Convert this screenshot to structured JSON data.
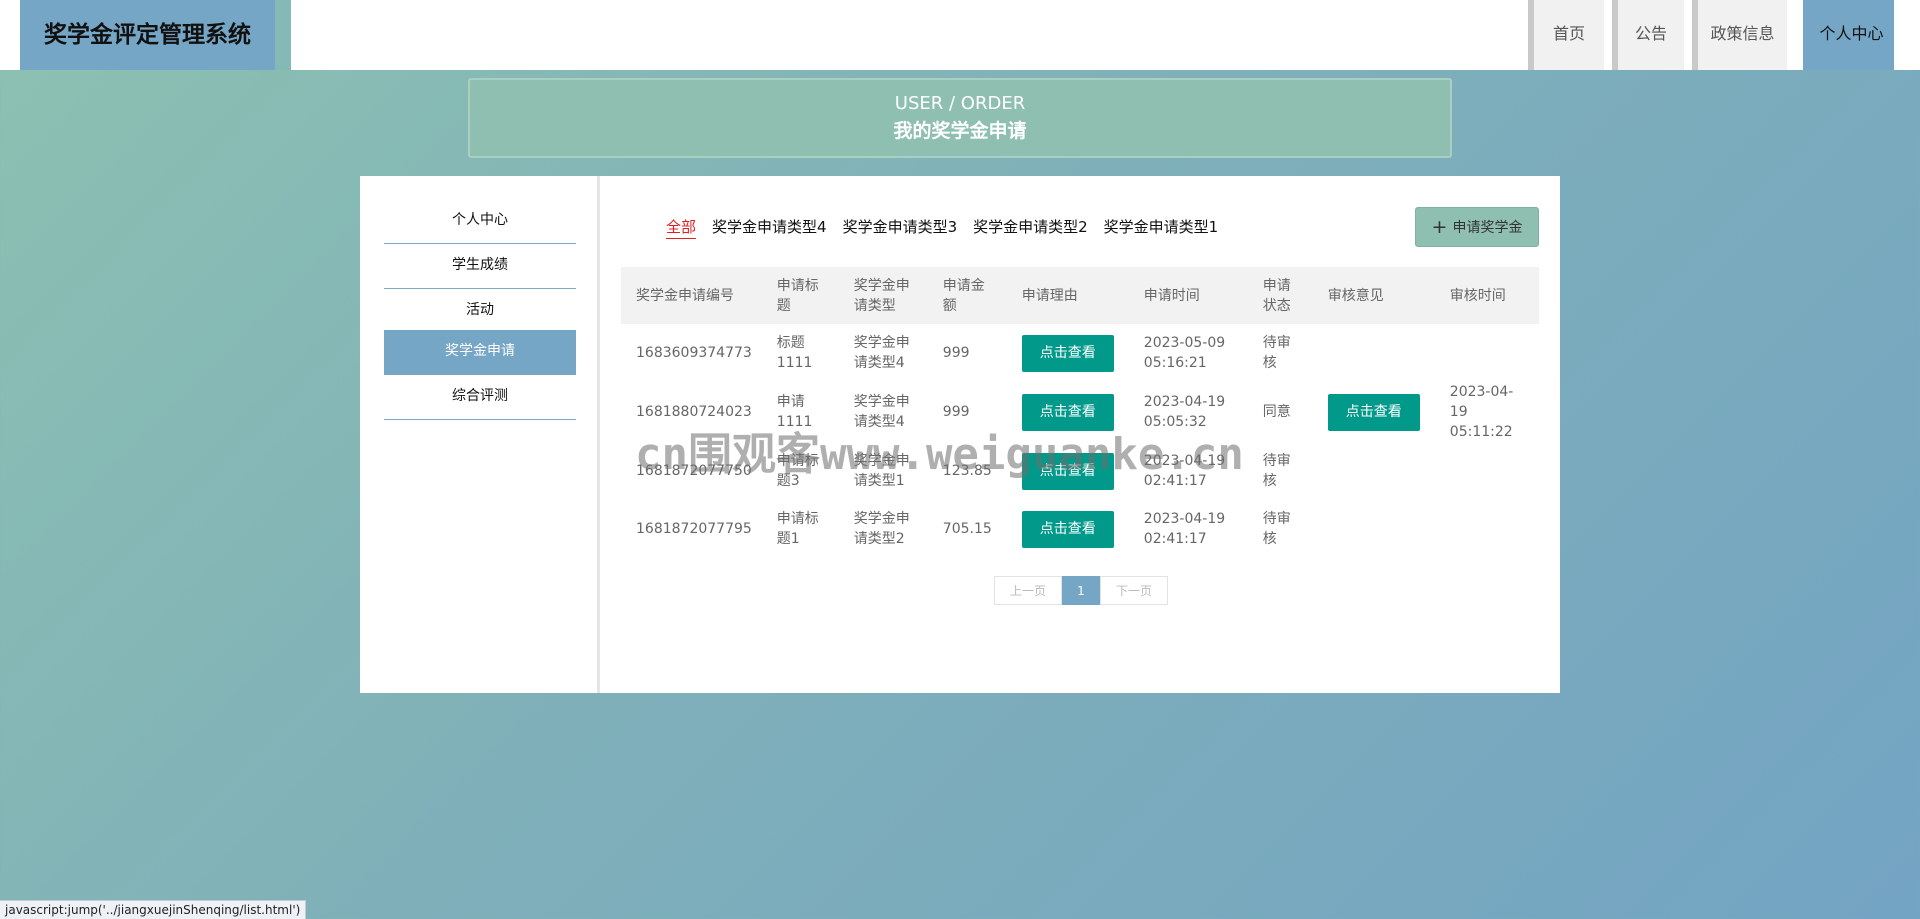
{
  "app": {
    "title": "奖学金评定管理系统"
  },
  "nav": {
    "items": [
      "首页",
      "公告",
      "政策信息",
      "个人中心"
    ],
    "active": "个人中心"
  },
  "header": {
    "en": "USER / ORDER",
    "zh": "我的奖学金申请"
  },
  "sidebar": {
    "items": [
      "个人中心",
      "学生成绩",
      "活动",
      "奖学金申请",
      "综合评测"
    ],
    "active": "奖学金申请"
  },
  "filter_tabs": {
    "items": [
      "全部",
      "奖学金申请类型4",
      "奖学金申请类型3",
      "奖学金申请类型2",
      "奖学金申请类型1"
    ],
    "active": "全部"
  },
  "apply_button": {
    "icon": "plus-icon",
    "label": "申请奖学金"
  },
  "table": {
    "headers": [
      "奖学金申请编号",
      "申请标题",
      "奖学金申请类型",
      "申请金额",
      "申请理由",
      "申请时间",
      "申请状态",
      "审核意见",
      "审核时间"
    ],
    "view_label": "点击查看",
    "rows": [
      {
        "no": "1683609374773",
        "title": "标题1111",
        "type": "奖学金申请类型4",
        "amount": "999",
        "time": "2023-05-09 05:16:21",
        "status": "待审核",
        "opinion": "",
        "review_time": ""
      },
      {
        "no": "1681880724023",
        "title": "申请1111",
        "type": "奖学金申请类型4",
        "amount": "999",
        "time": "2023-04-19 05:05:32",
        "status": "同意",
        "opinion": "点击查看",
        "review_time": "2023-04-19 05:11:22"
      },
      {
        "no": "1681872077750",
        "title": "申请标题3",
        "type": "奖学金申请类型1",
        "amount": "123.85",
        "time": "2023-04-19 02:41:17",
        "status": "待审核",
        "opinion": "",
        "review_time": ""
      },
      {
        "no": "1681872077795",
        "title": "申请标题1",
        "type": "奖学金申请类型2",
        "amount": "705.15",
        "time": "2023-04-19 02:41:17",
        "status": "待审核",
        "opinion": "",
        "review_time": ""
      }
    ]
  },
  "pagination": {
    "prev": "上一页",
    "current": "1",
    "next": "下一页"
  },
  "watermark": "cn围观客www.weiguanke.cn",
  "status_bar": "javascript:jump('../jiangxuejinShenqing/list.html')"
}
